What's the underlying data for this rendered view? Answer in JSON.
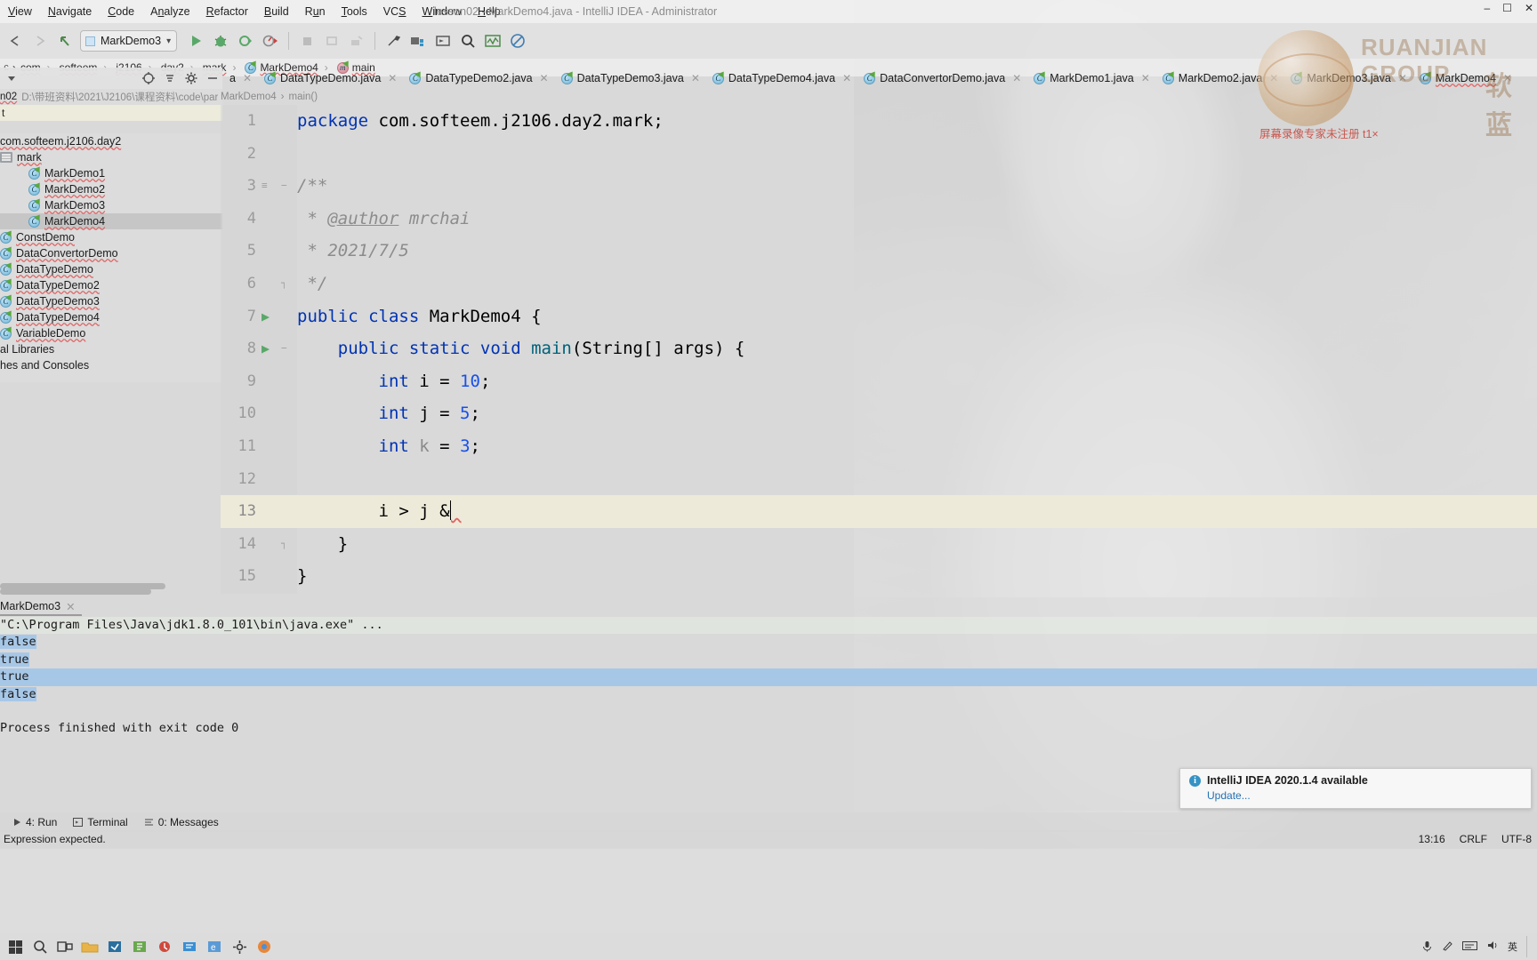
{
  "window": {
    "title": "lesson02 - MarkDemo4.java - IntelliJ IDEA - Administrator",
    "minimize": "–",
    "maximize": "☐",
    "close": "✕"
  },
  "menubar": {
    "items": [
      {
        "label": "View"
      },
      {
        "label": "Navigate"
      },
      {
        "label": "Code"
      },
      {
        "label": "Analyze"
      },
      {
        "label": "Refactor"
      },
      {
        "label": "Build"
      },
      {
        "label": "Run"
      },
      {
        "label": "Tools"
      },
      {
        "label": "VCS"
      },
      {
        "label": "Window"
      },
      {
        "label": "Help"
      }
    ]
  },
  "toolbar": {
    "run_config": "MarkDemo3",
    "dropdown_caret": "▾",
    "icons": [
      "back-icon",
      "forward-icon",
      "undo-arrow-icon",
      "run-icon",
      "debug-icon",
      "run-with-coverage-icon",
      "profile-icon",
      "stop-icon",
      "attach-icon",
      "build-icon",
      "settings-wrench-icon",
      "project-structure-icon",
      "terminal-icon",
      "search-everywhere-icon",
      "analyze-icon",
      "no-inspection-icon"
    ]
  },
  "breadcrumb": {
    "items": [
      "com",
      "softeem",
      "j2106",
      "day2",
      "mark",
      "MarkDemo4",
      "main"
    ],
    "separator": "›"
  },
  "project": {
    "module": "n02",
    "path": "D:\\带班资料\\2021\\J2106\\课程资料\\code\\par",
    "ext_row": "t",
    "tree": [
      {
        "label": "com.softeem.j2106.day2",
        "indent": 0,
        "kind": "package-name",
        "selected": false
      },
      {
        "label": "mark",
        "indent": 0,
        "kind": "package",
        "selected": false
      },
      {
        "label": "MarkDemo1",
        "indent": 2,
        "kind": "class",
        "selected": false
      },
      {
        "label": "MarkDemo2",
        "indent": 2,
        "kind": "class",
        "selected": false
      },
      {
        "label": "MarkDemo3",
        "indent": 2,
        "kind": "class",
        "selected": false
      },
      {
        "label": "MarkDemo4",
        "indent": 2,
        "kind": "class",
        "selected": true
      },
      {
        "label": "ConstDemo",
        "indent": 0,
        "kind": "class",
        "selected": false
      },
      {
        "label": "DataConvertorDemo",
        "indent": 0,
        "kind": "class",
        "selected": false
      },
      {
        "label": "DataTypeDemo",
        "indent": 0,
        "kind": "class",
        "selected": false
      },
      {
        "label": "DataTypeDemo2",
        "indent": 0,
        "kind": "class",
        "selected": false
      },
      {
        "label": "DataTypeDemo3",
        "indent": 0,
        "kind": "class",
        "selected": false
      },
      {
        "label": "DataTypeDemo4",
        "indent": 0,
        "kind": "class",
        "selected": false
      },
      {
        "label": "VariableDemo",
        "indent": 0,
        "kind": "class",
        "selected": false
      },
      {
        "label": "al Libraries",
        "indent": 0,
        "kind": "plain",
        "selected": false
      },
      {
        "label": "hes and Consoles",
        "indent": 0,
        "kind": "plain",
        "selected": false
      }
    ]
  },
  "editor": {
    "tabs": [
      {
        "label": "a",
        "truncated": true
      },
      {
        "label": "DataTypeDemo.java"
      },
      {
        "label": "DataTypeDemo2.java"
      },
      {
        "label": "DataTypeDemo3.java"
      },
      {
        "label": "DataTypeDemo4.java"
      },
      {
        "label": "DataConvertorDemo.java"
      },
      {
        "label": "MarkDemo1.java"
      },
      {
        "label": "MarkDemo2.java"
      },
      {
        "label": "MarkDemo3.java"
      },
      {
        "label": "MarkDemo4",
        "active": true
      }
    ],
    "crumb": [
      "MarkDemo4",
      "main()"
    ],
    "crumb_separator": "›",
    "lines": [
      {
        "n": "1",
        "segments": [
          {
            "t": "package ",
            "c": "kw"
          },
          {
            "t": "com.softeem.j2106.day2.mark;",
            "c": ""
          }
        ]
      },
      {
        "n": "2",
        "segments": []
      },
      {
        "n": "3",
        "segments": [
          {
            "t": "/**",
            "c": "cmt"
          }
        ],
        "fold": true,
        "docmark": true
      },
      {
        "n": "4",
        "segments": [
          {
            "t": " * ",
            "c": "cmt"
          },
          {
            "t": "@author",
            "c": "cmt-u"
          },
          {
            "t": " mrchai",
            "c": "cmt"
          }
        ]
      },
      {
        "n": "5",
        "segments": [
          {
            "t": " * 2021/7/5",
            "c": "cmt"
          }
        ]
      },
      {
        "n": "6",
        "segments": [
          {
            "t": " */",
            "c": "cmt"
          }
        ],
        "foldend": true
      },
      {
        "n": "7",
        "segments": [
          {
            "t": "public class ",
            "c": "kw"
          },
          {
            "t": "MarkDemo4 {",
            "c": ""
          }
        ],
        "run": true
      },
      {
        "n": "8",
        "segments": [
          {
            "t": "    ",
            "c": ""
          },
          {
            "t": "public static void ",
            "c": "kw"
          },
          {
            "t": "main",
            "c": "method"
          },
          {
            "t": "(String[] args) {",
            "c": ""
          }
        ],
        "run": true,
        "fold": true
      },
      {
        "n": "9",
        "segments": [
          {
            "t": "        ",
            "c": ""
          },
          {
            "t": "int ",
            "c": "kw"
          },
          {
            "t": "i = ",
            "c": ""
          },
          {
            "t": "10",
            "c": "num"
          },
          {
            "t": ";",
            "c": ""
          }
        ]
      },
      {
        "n": "10",
        "segments": [
          {
            "t": "        ",
            "c": ""
          },
          {
            "t": "int ",
            "c": "kw"
          },
          {
            "t": "j = ",
            "c": ""
          },
          {
            "t": "5",
            "c": "num"
          },
          {
            "t": ";",
            "c": ""
          }
        ]
      },
      {
        "n": "11",
        "segments": [
          {
            "t": "        ",
            "c": ""
          },
          {
            "t": "int ",
            "c": "kw"
          },
          {
            "t": "k",
            "c": "dim"
          },
          {
            "t": " = ",
            "c": ""
          },
          {
            "t": "3",
            "c": "num"
          },
          {
            "t": ";",
            "c": ""
          }
        ]
      },
      {
        "n": "12",
        "segments": []
      },
      {
        "n": "13",
        "segments": [
          {
            "t": "        i > j &",
            "c": ""
          }
        ],
        "current": true,
        "caret": true,
        "error": true
      },
      {
        "n": "14",
        "segments": [
          {
            "t": "    }",
            "c": ""
          }
        ],
        "foldend": true
      },
      {
        "n": "15",
        "segments": [
          {
            "t": "}",
            "c": ""
          }
        ]
      }
    ]
  },
  "run_panel": {
    "tab_label": "MarkDemo3",
    "close": "✕",
    "console": [
      {
        "text": "\"C:\\Program Files\\Java\\jdk1.8.0_101\\bin\\java.exe\" ...",
        "style": "cmd"
      },
      {
        "text": "false",
        "style": "sel-text"
      },
      {
        "text": "true",
        "style": "sel-text"
      },
      {
        "text": "true",
        "style": "hl-full"
      },
      {
        "text": "false",
        "style": "sel-text"
      },
      {
        "text": "",
        "style": ""
      },
      {
        "text": "Process finished with exit code 0",
        "style": ""
      }
    ]
  },
  "tool_buttons": [
    {
      "label": "4: Run",
      "icon": "run-icon"
    },
    {
      "label": "Terminal",
      "icon": "terminal-icon"
    },
    {
      "label": "0: Messages",
      "icon": "messages-icon"
    }
  ],
  "statusbar": {
    "message": "Expression expected.",
    "caret_position": "13:16",
    "line_separator": "CRLF",
    "encoding": "UTF-8"
  },
  "notification": {
    "badge": "i",
    "title": "IntelliJ IDEA 2020.1.4 available",
    "action": "Update..."
  },
  "logo_watermark": {
    "line1": "RUANJIAN",
    "line2": "GROUP",
    "cn": "软蓝",
    "note": "屏幕录像专家未注册  t1×"
  },
  "taskbar": {
    "icons": [
      "windows-start-icon",
      "search-icon",
      "task-view-icon",
      "explorer-icon",
      "app-icon-1",
      "app-icon-2",
      "app-icon-3",
      "app-icon-4",
      "app-icon-5",
      "settings-icon",
      "browser-icon"
    ],
    "tray": [
      "microphone-icon",
      "pen-icon",
      "keyboard-icon",
      "speaker-icon",
      "ime-cn",
      "show-desktop"
    ],
    "ime_label": "英"
  },
  "colors": {
    "accent_blue": "#3592c4",
    "keyword": "#0033b3",
    "number": "#1750eb",
    "comment": "#8c8c8c",
    "error": "#e06666",
    "run_green": "#59a869",
    "selection": "#a7c7e7",
    "current_line": "#edeada"
  }
}
